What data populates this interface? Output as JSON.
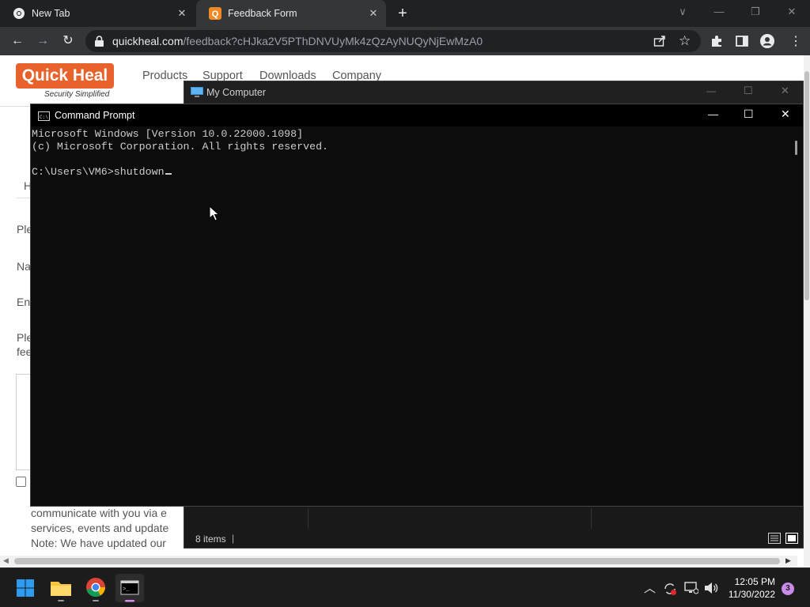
{
  "browser": {
    "tabs": [
      {
        "title": "New Tab",
        "icon": "chrome-icon",
        "active": false
      },
      {
        "title": "Feedback Form",
        "icon": "quickheal-favicon",
        "active": true
      }
    ],
    "new_tab_symbol": "+",
    "url_domain": "quickheal.com",
    "url_path": "/feedback?cHJka2V5PThDNVUyMk4zQzAyNUQyNjEwMzA0",
    "window_controls": [
      "∨",
      "—",
      "❐",
      "✕"
    ]
  },
  "webpage": {
    "logo_text": "Quick Heal",
    "logo_tagline": "Security Simplified",
    "nav": [
      "Products",
      "Support",
      "Downloads",
      "Company"
    ],
    "fragments": {
      "h": "H",
      "ple": "Ple",
      "na": "Na",
      "em": "En",
      "ple2": "Ple",
      "fee": "fee"
    },
    "consent_lines": [
      "communicate with you via e",
      "services, events and update",
      "Note: We have updated our"
    ]
  },
  "explorer": {
    "title": "My Computer",
    "status": "8 items",
    "controls": [
      "—",
      "☐",
      "✕"
    ]
  },
  "cmd": {
    "title": "Command Prompt",
    "lines": [
      "Microsoft Windows [Version 10.0.22000.1098]",
      "(c) Microsoft Corporation. All rights reserved.",
      "",
      "C:\\Users\\VM6>shutdown"
    ],
    "controls": [
      "—",
      "☐",
      "✕"
    ]
  },
  "taskbar": {
    "apps": [
      "windows-start",
      "file-explorer",
      "chrome",
      "command-prompt"
    ],
    "time": "12:05 PM",
    "date": "11/30/2022",
    "notification_count": "3"
  }
}
